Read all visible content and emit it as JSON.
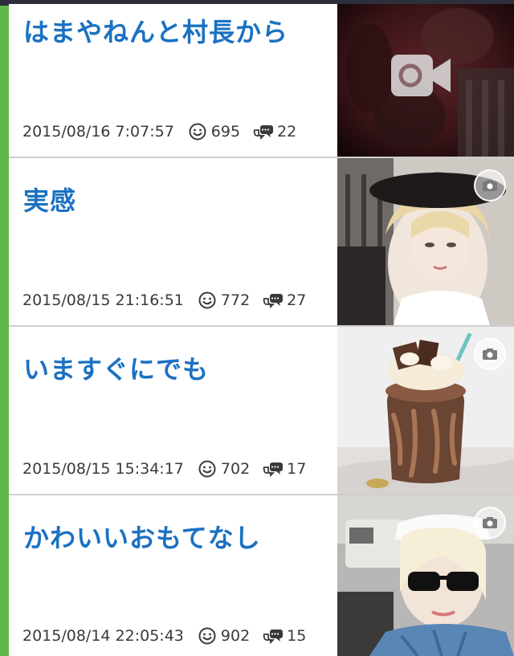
{
  "posts": [
    {
      "title": "はまやねんと村長から",
      "date": "2015/08/16 7:07:57",
      "likes": "695",
      "comments": "22",
      "media": "video-icon"
    },
    {
      "title": "実感",
      "date": "2015/08/15 21:16:51",
      "likes": "772",
      "comments": "27",
      "media": "camera-icon"
    },
    {
      "title": "いますぐにでも",
      "date": "2015/08/15 15:34:17",
      "likes": "702",
      "comments": "17",
      "media": "camera-icon"
    },
    {
      "title": "かわいいおもてなし",
      "date": "2015/08/14 22:05:43",
      "likes": "902",
      "comments": "15",
      "media": "camera-icon"
    }
  ],
  "colors": {
    "title": "#1b71c2",
    "side_accent": "#5fb84a",
    "meta_text": "#3a3a3a"
  }
}
